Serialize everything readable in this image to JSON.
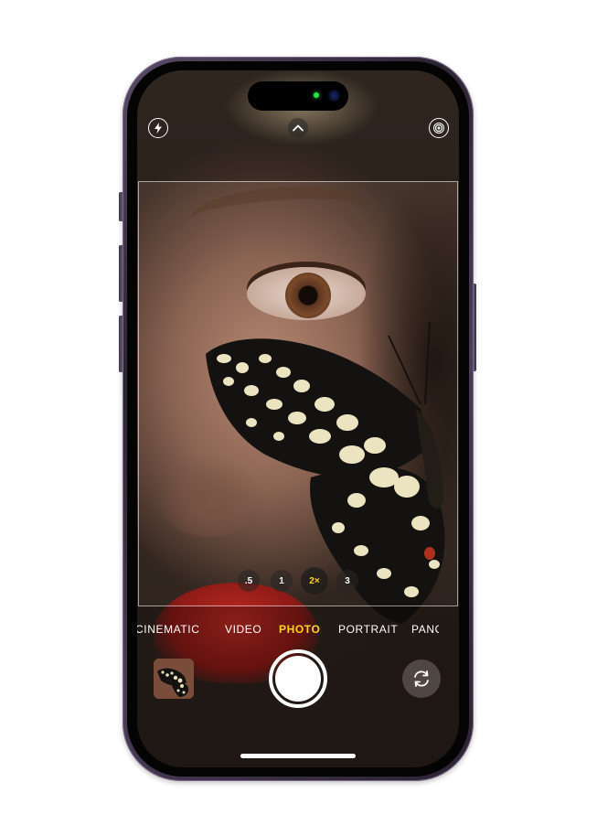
{
  "camera": {
    "zoom_levels": [
      {
        "label": ".5",
        "active": false
      },
      {
        "label": "1",
        "active": false
      },
      {
        "label": "2×",
        "active": true
      },
      {
        "label": "3",
        "active": false
      }
    ],
    "modes": [
      {
        "label": "CINEMATIC",
        "active": false
      },
      {
        "label": "VIDEO",
        "active": false
      },
      {
        "label": "PHOTO",
        "active": true
      },
      {
        "label": "PORTRAIT",
        "active": false
      },
      {
        "label": "PANO",
        "active": false
      }
    ],
    "top_controls": {
      "flash": "flash-icon",
      "expand": "chevron-up-icon",
      "live_photo": "live-photo-icon"
    },
    "bottom_controls": {
      "thumbnail": "last-photo-thumbnail",
      "shutter": "shutter-button",
      "flip": "camera-flip-icon"
    }
  },
  "colors": {
    "accent": "#ffd60a",
    "frame": "#4a3d57",
    "island_indicator": "#29e24a",
    "lip_red": "#c02a22"
  }
}
